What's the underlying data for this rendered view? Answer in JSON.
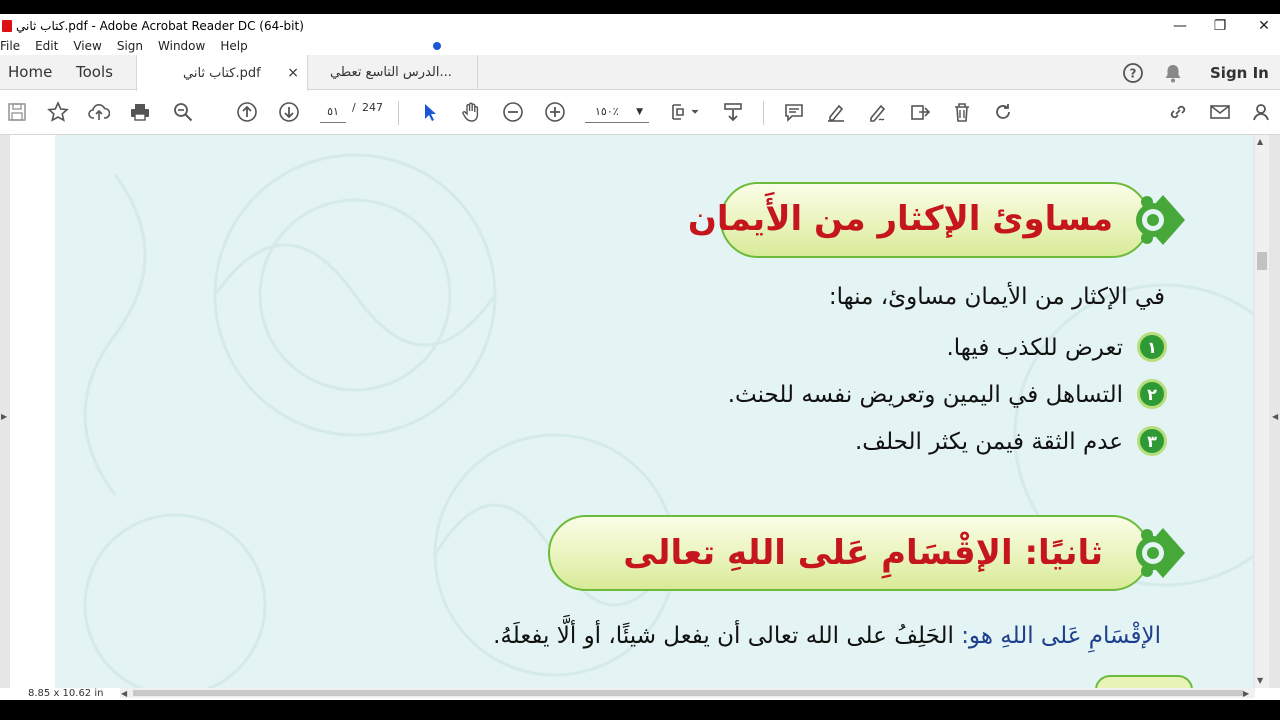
{
  "window": {
    "title": "كتاب ثاني.pdf - Adobe Acrobat Reader DC (64-bit)",
    "minimize": "—",
    "maximize": "❐",
    "close": "✕"
  },
  "menu": [
    "File",
    "Edit",
    "View",
    "Sign",
    "Window",
    "Help"
  ],
  "tabs": {
    "home": "Home",
    "tools": "Tools",
    "docs": [
      {
        "label": "كتاب ثاني.pdf",
        "close": "×",
        "active": true
      },
      {
        "label": "الدرس التاسع تعطي...",
        "active": false
      }
    ],
    "sign_in": "Sign In"
  },
  "toolbar": {
    "page_current": "٥١",
    "page_separator": "/",
    "page_total": "247",
    "zoom": "١٥٠٪",
    "icons": [
      "save-icon",
      "bookmark-star-icon",
      "upload-icon",
      "print-icon",
      "zoom-search-icon",
      "page-up-icon",
      "page-down-icon",
      "select-cursor-icon",
      "hand-icon",
      "zoom-out-icon",
      "zoom-in-icon",
      "fit-page-icon",
      "scroll-mode-icon",
      "comment-icon",
      "highlight-icon",
      "sign-icon",
      "share-edit-icon",
      "delete-icon",
      "rotate-icon",
      "link-icon",
      "email-icon",
      "account-icon"
    ]
  },
  "document": {
    "heading1": "مساوئ الإكثار من الأَيمان",
    "intro": "في الإكثار من الأيمان مساوئ، منها:",
    "items": [
      {
        "num": "١",
        "text": "تعرض للكذب فيها."
      },
      {
        "num": "٢",
        "text": "التساهل في اليمين وتعريض نفسه للحنث."
      },
      {
        "num": "٣",
        "text": "عدم الثقة فيمن يكثر الحلف."
      }
    ],
    "heading2": "ثانيًا: الإقْسَامِ عَلى اللهِ تعالى",
    "definition_term": "الإقْسَامِ عَلى اللهِ هو:",
    "definition_body": " الحَلِفُ على الله تعالى أن يفعل شيئًا، أو ألَّا يفعلَهُ."
  },
  "status": {
    "page_size": "8.85 x 10.62 in"
  },
  "colors": {
    "heading_red": "#c4161c",
    "accent_green": "#2e9a36",
    "page_bg": "#e4f3f3",
    "definition_blue": "#1f3f8f"
  }
}
